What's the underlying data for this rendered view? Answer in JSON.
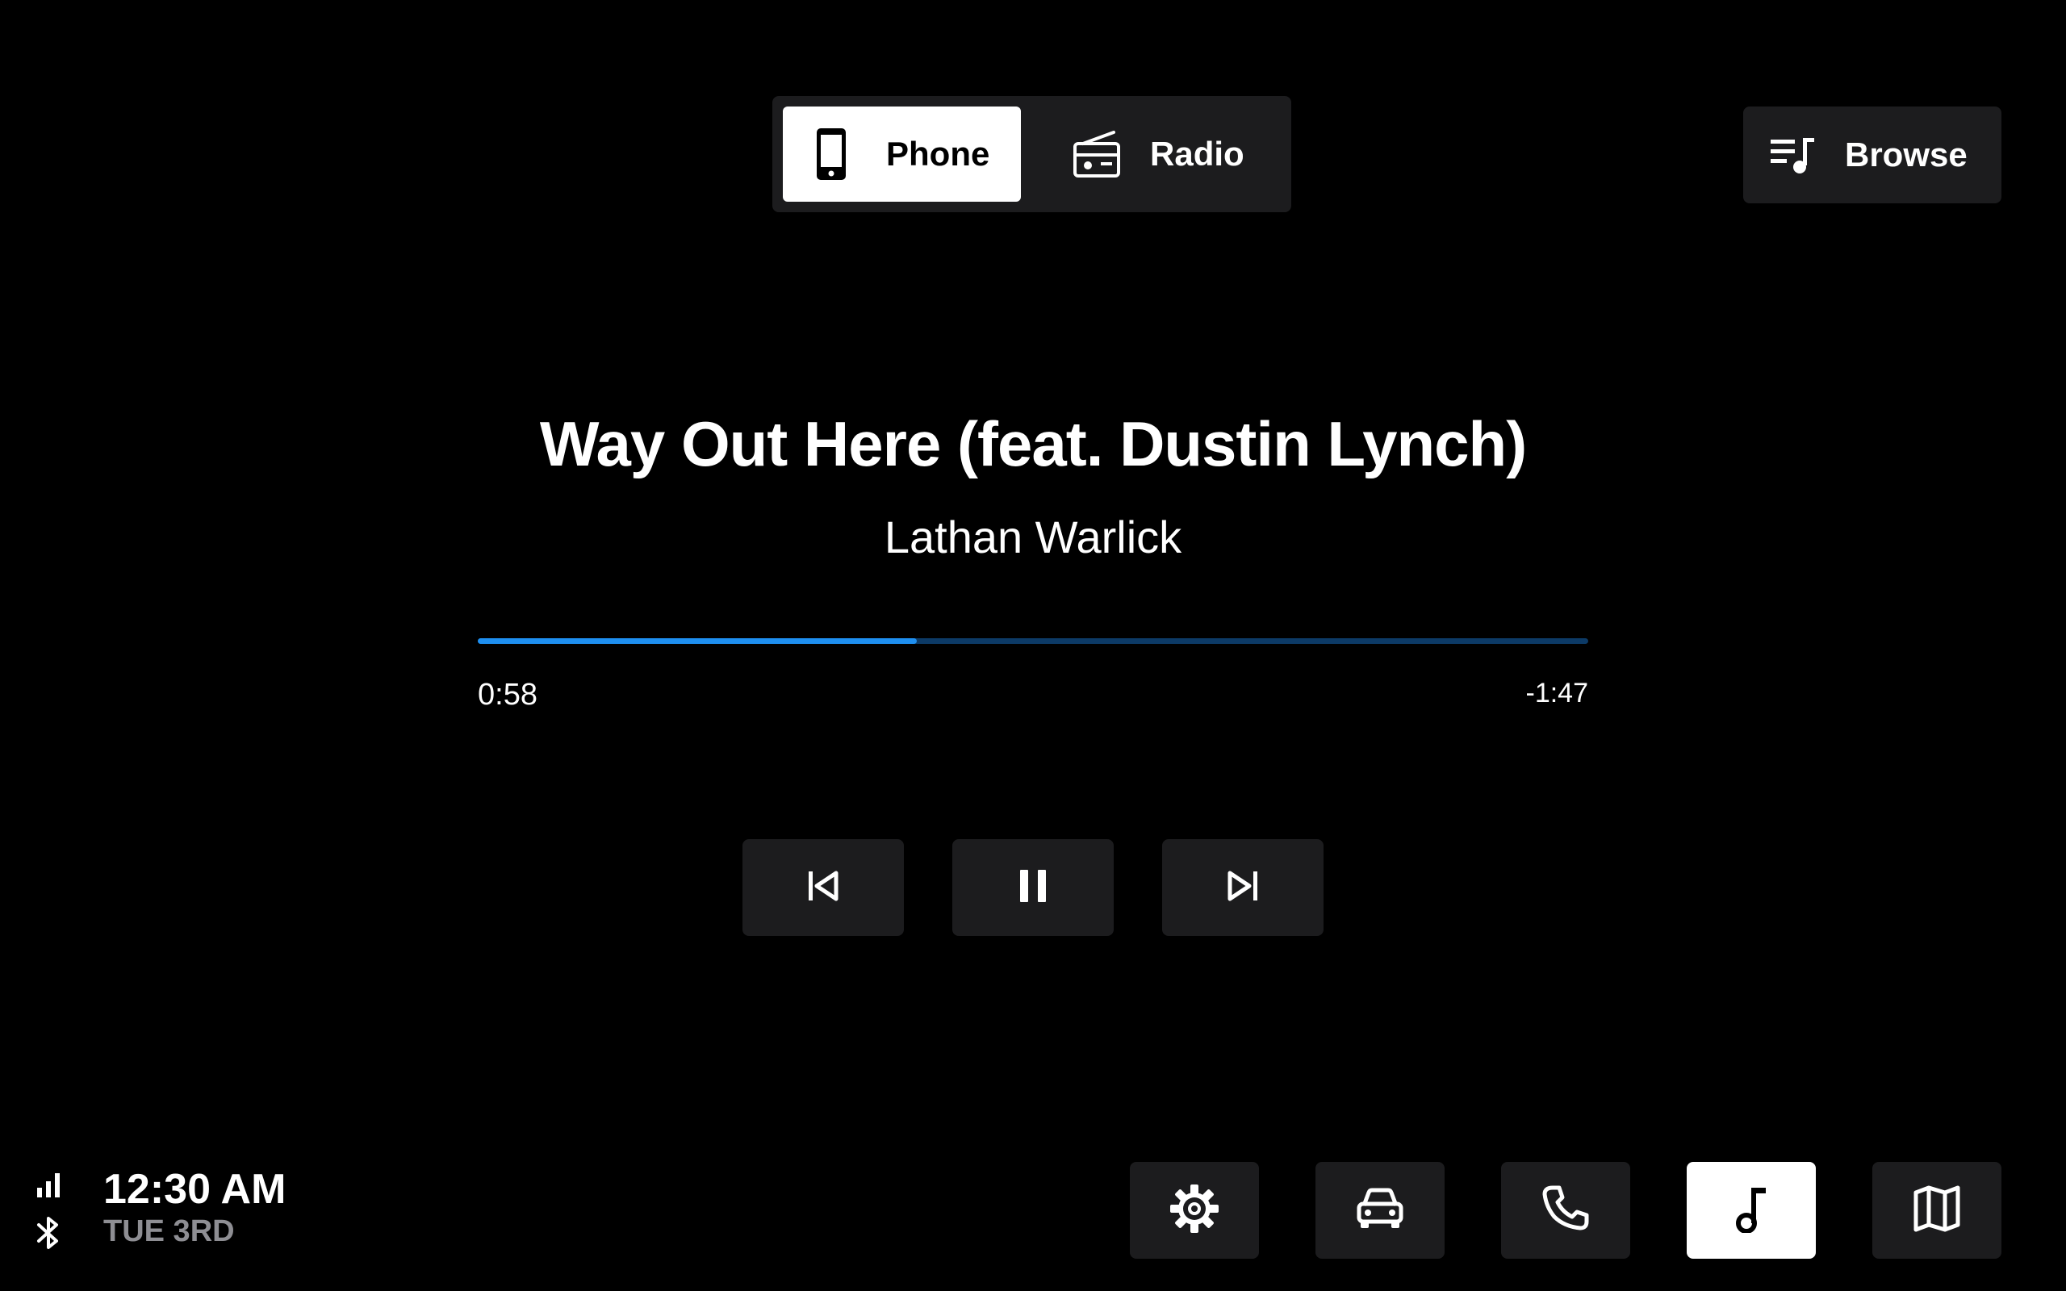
{
  "source_toggle": {
    "options": [
      {
        "label": "Phone",
        "icon": "smartphone-icon",
        "selected": true
      },
      {
        "label": "Radio",
        "icon": "radio-icon",
        "selected": false
      }
    ]
  },
  "browse": {
    "label": "Browse",
    "icon": "playlist-icon"
  },
  "track": {
    "title": "Way Out Here (feat. Dustin Lynch)",
    "artist": "Lathan Warlick"
  },
  "playback": {
    "elapsed": "0:58",
    "remaining": "-1:47",
    "progress_fraction": 0.395
  },
  "controls": {
    "previous_icon": "skip-previous-icon",
    "pause_icon": "pause-icon",
    "next_icon": "skip-next-icon"
  },
  "status": {
    "time": "12:30 AM",
    "date": "TUE 3RD",
    "signal_icon": "signal-bars-icon",
    "bluetooth_icon": "bluetooth-icon"
  },
  "bottom_nav": {
    "items": [
      {
        "icon": "gear-icon",
        "active": false
      },
      {
        "icon": "car-icon",
        "active": false
      },
      {
        "icon": "phone-handset-icon",
        "active": false
      },
      {
        "icon": "music-note-icon",
        "active": true
      },
      {
        "icon": "map-icon",
        "active": false
      }
    ]
  },
  "colors": {
    "background": "#000000",
    "panel": "#1c1c1e",
    "accent": "#1e8ff0",
    "progress_track": "#0c3a66",
    "secondary_text": "#8e8e93"
  }
}
